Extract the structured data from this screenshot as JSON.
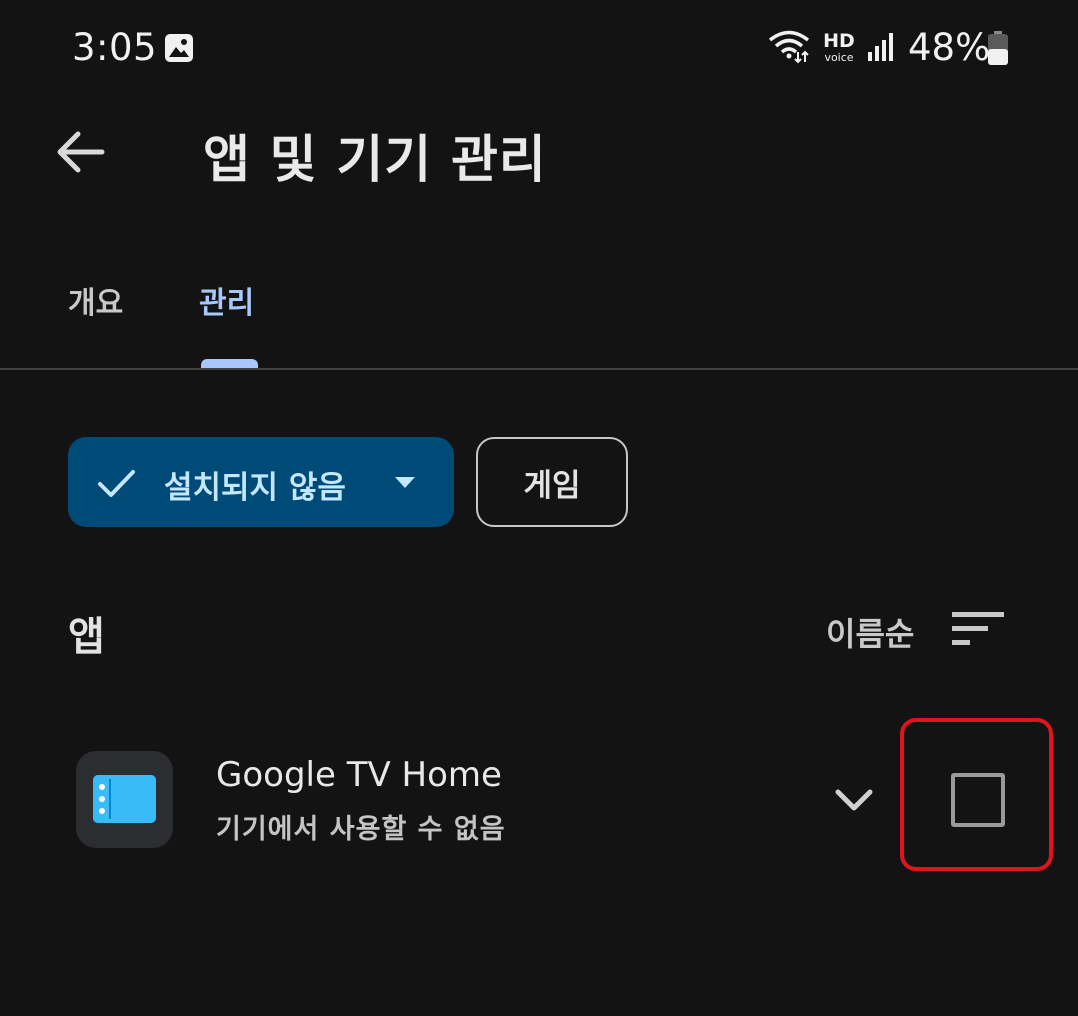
{
  "status_bar": {
    "time": "3:05",
    "hd": "HD",
    "voice": "voice",
    "battery": "48%",
    "icons": [
      "gallery-icon",
      "wifi-icon",
      "signal-icon",
      "battery-icon"
    ]
  },
  "header": {
    "title": "앱 및 기기 관리",
    "back_icon": "arrow-left-icon"
  },
  "tabs": [
    {
      "label": "개요",
      "selected": false
    },
    {
      "label": "관리",
      "selected": true
    }
  ],
  "filters": {
    "not_installed": {
      "label": "설치되지 않음",
      "selected": true,
      "icons": [
        "check-icon",
        "caret-down-icon"
      ]
    },
    "games": {
      "label": "게임",
      "selected": false
    }
  },
  "section": {
    "title": "앱",
    "sort_label": "이름순",
    "sort_icon": "sort-icon"
  },
  "apps": [
    {
      "name": "Google TV Home",
      "status": "기기에서 사용할 수 없음",
      "checked": false
    }
  ],
  "colors": {
    "background": "#131314",
    "accent": "#a8c7fa",
    "chip_selected_bg": "#004a77",
    "chip_selected_text": "#c2e7ff",
    "highlight": "#e0141e"
  }
}
